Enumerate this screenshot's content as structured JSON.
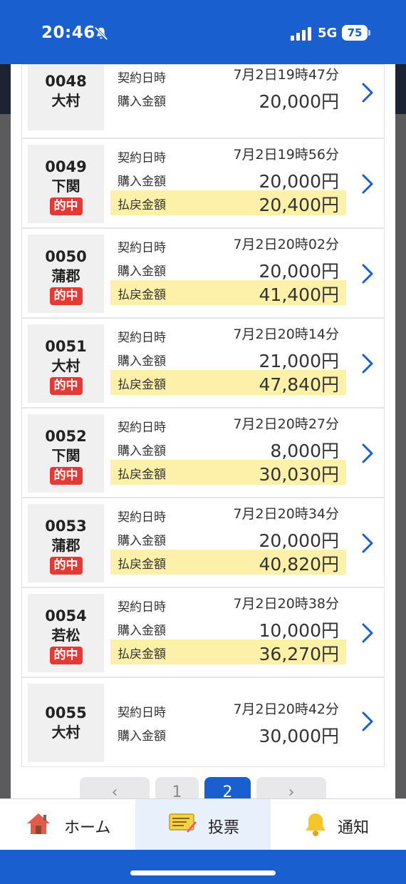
{
  "status": {
    "time": "20:46",
    "network": "5G",
    "battery": "75"
  },
  "labels": {
    "contract": "契約日時",
    "purchase": "購入金額",
    "payout": "払戻金額",
    "hit_badge": "的中"
  },
  "rows": [
    {
      "num": "0048",
      "venue": "大村",
      "contract": "7月2日19時47分",
      "purchase": "20,000円",
      "hit": false,
      "payout": ""
    },
    {
      "num": "0049",
      "venue": "下関",
      "contract": "7月2日19時56分",
      "purchase": "20,000円",
      "hit": true,
      "payout": "20,400円"
    },
    {
      "num": "0050",
      "venue": "蒲郡",
      "contract": "7月2日20時02分",
      "purchase": "20,000円",
      "hit": true,
      "payout": "41,400円"
    },
    {
      "num": "0051",
      "venue": "大村",
      "contract": "7月2日20時14分",
      "purchase": "21,000円",
      "hit": true,
      "payout": "47,840円"
    },
    {
      "num": "0052",
      "venue": "下関",
      "contract": "7月2日20時27分",
      "purchase": "8,000円",
      "hit": true,
      "payout": "30,030円"
    },
    {
      "num": "0053",
      "venue": "蒲郡",
      "contract": "7月2日20時34分",
      "purchase": "20,000円",
      "hit": true,
      "payout": "40,820円"
    },
    {
      "num": "0054",
      "venue": "若松",
      "contract": "7月2日20時38分",
      "purchase": "10,000円",
      "hit": true,
      "payout": "36,270円"
    },
    {
      "num": "0055",
      "venue": "大村",
      "contract": "7月2日20時42分",
      "purchase": "30,000円",
      "hit": false,
      "payout": ""
    }
  ],
  "pagination": {
    "prev": "‹",
    "page1": "1",
    "page2": "2",
    "next": "›"
  },
  "tabs": {
    "home": "ホーム",
    "vote": "投票",
    "notify": "通知"
  },
  "colors": {
    "accent": "#1a5fd0",
    "hit_badge": "#e53935",
    "payout_highlight": "#fdf0a8"
  }
}
